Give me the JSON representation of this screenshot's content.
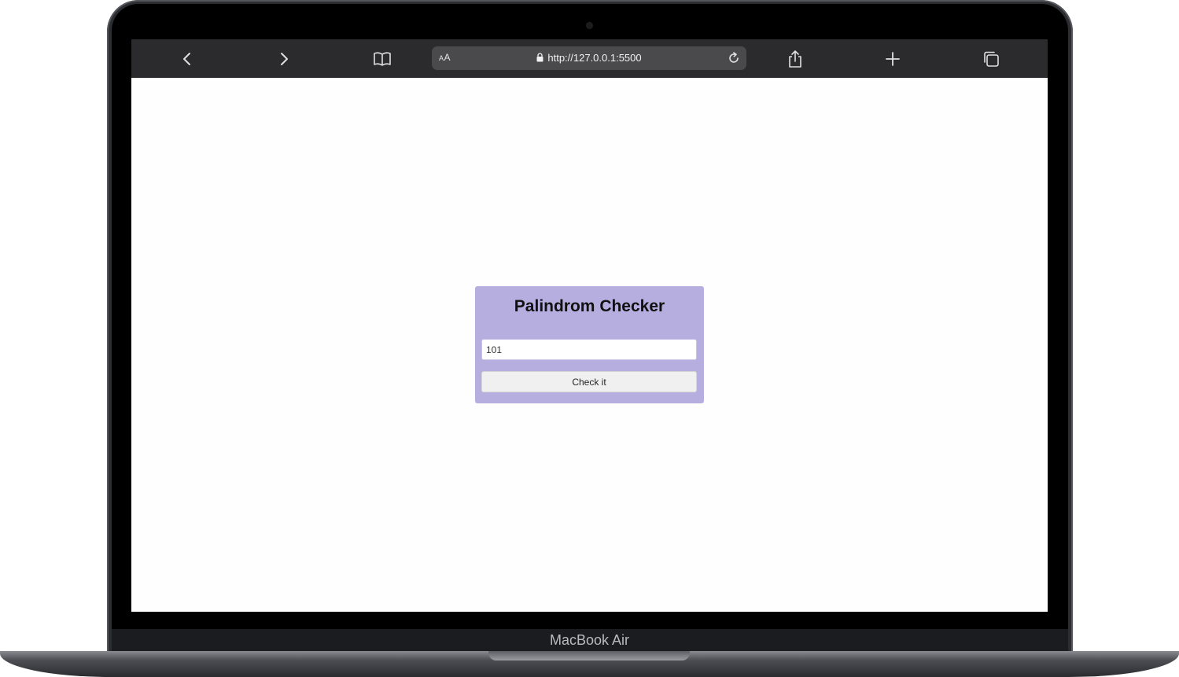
{
  "browser": {
    "text_size_label": "AA",
    "url": "http://127.0.0.1:5500",
    "icons": {
      "back": "chevron-left-icon",
      "forward": "chevron-right-icon",
      "bookmarks": "book-icon",
      "lock": "lock-icon",
      "reload": "reload-icon",
      "share": "share-icon",
      "new_tab": "plus-icon",
      "tabs": "tabs-icon"
    }
  },
  "app": {
    "title": "Palindrom Checker",
    "input_value": "101",
    "button_label": "Check it",
    "card_color": "#b7aee0"
  },
  "device": {
    "label": "MacBook Air"
  }
}
